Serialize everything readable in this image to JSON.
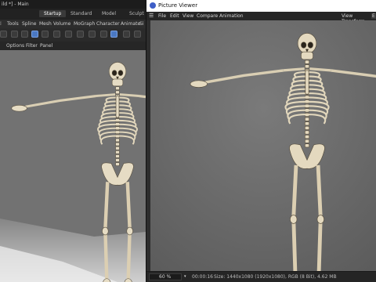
{
  "c4d": {
    "title": "ild *] - Main",
    "layouts": [
      "Startup",
      "Standard",
      "Model",
      "Sculpt"
    ],
    "active_layout": "Startup",
    "menu": [
      "Tools",
      "Spline",
      "Mesh",
      "Volume",
      "MoGraph",
      "Character",
      "Animate",
      "Si"
    ],
    "viewport_menu": [
      "Options",
      "Filter",
      "Panel"
    ]
  },
  "picture_viewer": {
    "title": "Picture Viewer",
    "menu": [
      "File",
      "Edit",
      "View",
      "Compare",
      "Animation"
    ],
    "menu_right": "View Transform",
    "menu_right_value": "E",
    "status": {
      "zoom": "60 %",
      "time": "00:00:16",
      "info": "Size: 1440x1080 (1920x1080), RGB (8 Bit), 4.62 MB"
    }
  }
}
